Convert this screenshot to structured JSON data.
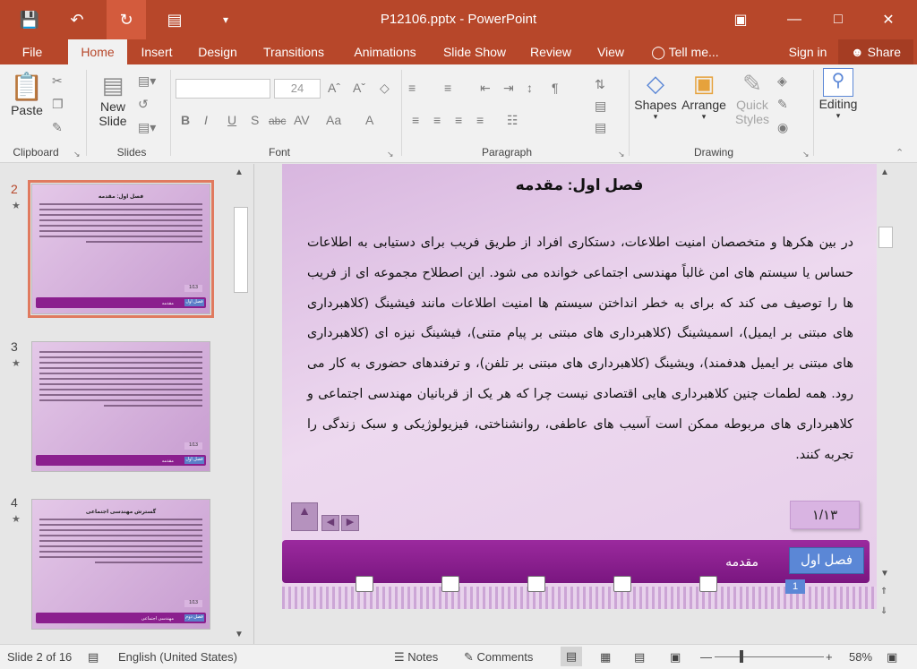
{
  "window": {
    "title": "P12106.pptx - PowerPoint"
  },
  "tabs": [
    "File",
    "Home",
    "Insert",
    "Design",
    "Transitions",
    "Animations",
    "Slide Show",
    "Review",
    "View",
    "Tell me...",
    "Sign in",
    "Share"
  ],
  "ribbon": {
    "paste": "Paste",
    "new_slide": "New",
    "new_slide2": "Slide",
    "font_size": "24",
    "shapes": "Shapes",
    "arrange": "Arrange",
    "quick_styles": "Quick",
    "quick_styles2": "Styles",
    "editing": "Editing",
    "groups": {
      "clipboard": "Clipboard",
      "slides": "Slides",
      "font": "Font",
      "paragraph": "Paragraph",
      "drawing": "Drawing"
    }
  },
  "thumbnails": [
    {
      "num": "2",
      "title": "فصل اول: مقدمه",
      "page": "1/13",
      "section": "مقدمه",
      "chapter": "فصل اول",
      "selected": true
    },
    {
      "num": "3",
      "title": "",
      "page": "1/13",
      "section": "مقدمه",
      "chapter": "فصل اول",
      "selected": false
    },
    {
      "num": "4",
      "title": "گسترش مهندسی اجتماعی",
      "page": "1/13",
      "section": "مهندسی اجتماعی",
      "chapter": "فصل دوم",
      "selected": false
    }
  ],
  "slide": {
    "title": "فصل اول: مقدمه",
    "body": "در بین هکرها و متخصصان امنیت اطلاعات، دستکاری افراد از طریق فریب برای دستیابی به اطلاعات حساس یا سیستم های امن غالباً مهندسی اجتماعی خوانده می شود. این اصطلاح مجموعه ای از فریب ها را توصیف می کند که برای به خطر انداختن سیستم ها امنیت اطلاعات مانند فیشینگ (کلاهبرداری های مبتنی بر ایمیل)، اسمیشینگ (کلاهبرداری های مبتنی بر پیام متنی)، فیشینگ نیزه ای (کلاهبرداری های مبتنی بر ایمیل هدفمند)، ویشینگ (کلاهبرداری های مبتنی بر تلفن)، و ترفندهای حضوری به کار می رود. همه لطمات چنین کلاهبرداری هایی اقتصادی نیست چرا که هر یک از قربانیان مهندسی اجتماعی و کلاهبرداری های مربوطه ممکن است آسیب های عاطفی، روانشناختی، فیزیولوژیکی و سبک زندگی را تجربه کنند.",
    "page_number": "۱/۱۳",
    "section": "مقدمه",
    "chapter_button": "فصل اول",
    "badge": "1"
  },
  "status": {
    "slide_pos": "Slide 2 of 16",
    "language": "English (United States)",
    "notes": "Notes",
    "comments": "Comments",
    "zoom": "58%"
  },
  "colors": {
    "accent": "#b7472a",
    "slide_bar": "#8b1f8e",
    "chapter_button": "#5b87d6"
  }
}
